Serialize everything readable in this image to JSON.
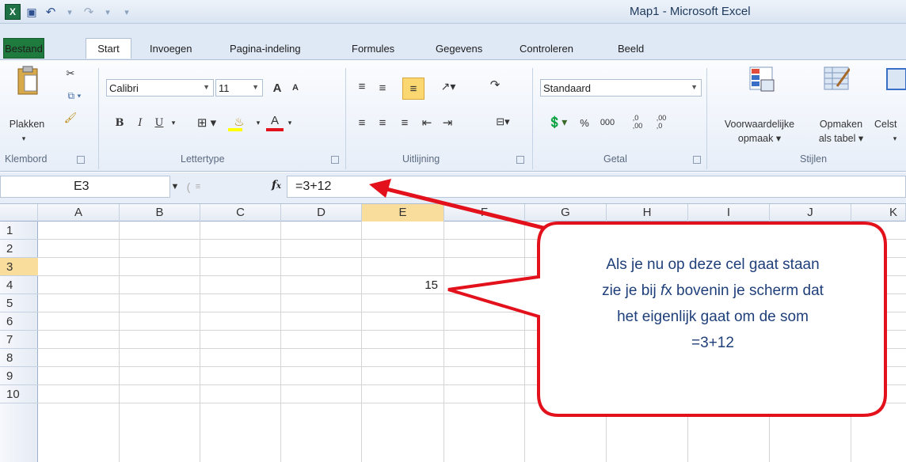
{
  "window": {
    "title": "Map1 - Microsoft Excel"
  },
  "qat": {
    "logo": "X",
    "save": "💾",
    "undo": "↶",
    "redo": "↷",
    "customize": "▾"
  },
  "tabs": [
    "Bestand",
    "Start",
    "Invoegen",
    "Pagina-indeling",
    "Formules",
    "Gegevens",
    "Controleren",
    "Beeld"
  ],
  "ribbon": {
    "clipboard": {
      "paste": "Plakken",
      "label": "Klembord"
    },
    "font": {
      "name": "Calibri",
      "size": "11",
      "bold": "B",
      "italic": "I",
      "underline": "U",
      "grow": "A",
      "shrink": "A",
      "color": "A",
      "label": "Lettertype"
    },
    "alignment": {
      "label": "Uitlijning"
    },
    "number": {
      "format": "Standaard",
      "percent": "%",
      "thousands": "000",
      "inc": ",0→,00",
      "dec": ",00→,0",
      "label": "Getal"
    },
    "styles": {
      "cond1": "Voorwaardelijke",
      "cond2": "opmaak",
      "table1": "Opmaken",
      "table2": "als tabel",
      "cell": "Celst",
      "label": "Stijlen"
    }
  },
  "formula_bar": {
    "cell_ref": "E3",
    "fx": "fx",
    "value": "=3+12"
  },
  "columns": [
    "A",
    "B",
    "C",
    "D",
    "E",
    "F",
    "G",
    "H",
    "I",
    "J",
    "K"
  ],
  "rows": [
    "1",
    "2",
    "3",
    "4",
    "5",
    "6",
    "7",
    "8",
    "9",
    "10"
  ],
  "cells": {
    "E3": "15"
  },
  "callout": {
    "lines": [
      "Als je nu op deze cel gaat staan",
      "zie je bij fx bovenin je scherm dat",
      "het eigenlijk gaat om de som",
      "=3+12"
    ]
  },
  "colors": {
    "excel_green": "#1f7a3d",
    "arrow_red": "#e3111b",
    "callout_text": "#1f3f7a"
  }
}
